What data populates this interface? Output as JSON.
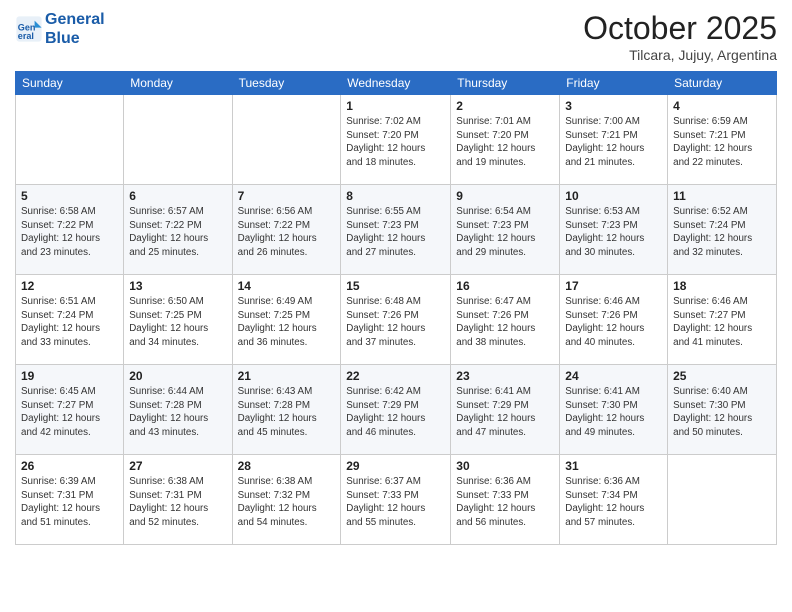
{
  "header": {
    "logo_line1": "General",
    "logo_line2": "Blue",
    "month": "October 2025",
    "location": "Tilcara, Jujuy, Argentina"
  },
  "days_of_week": [
    "Sunday",
    "Monday",
    "Tuesday",
    "Wednesday",
    "Thursday",
    "Friday",
    "Saturday"
  ],
  "weeks": [
    [
      {
        "day": "",
        "info": ""
      },
      {
        "day": "",
        "info": ""
      },
      {
        "day": "",
        "info": ""
      },
      {
        "day": "1",
        "info": "Sunrise: 7:02 AM\nSunset: 7:20 PM\nDaylight: 12 hours\nand 18 minutes."
      },
      {
        "day": "2",
        "info": "Sunrise: 7:01 AM\nSunset: 7:20 PM\nDaylight: 12 hours\nand 19 minutes."
      },
      {
        "day": "3",
        "info": "Sunrise: 7:00 AM\nSunset: 7:21 PM\nDaylight: 12 hours\nand 21 minutes."
      },
      {
        "day": "4",
        "info": "Sunrise: 6:59 AM\nSunset: 7:21 PM\nDaylight: 12 hours\nand 22 minutes."
      }
    ],
    [
      {
        "day": "5",
        "info": "Sunrise: 6:58 AM\nSunset: 7:22 PM\nDaylight: 12 hours\nand 23 minutes."
      },
      {
        "day": "6",
        "info": "Sunrise: 6:57 AM\nSunset: 7:22 PM\nDaylight: 12 hours\nand 25 minutes."
      },
      {
        "day": "7",
        "info": "Sunrise: 6:56 AM\nSunset: 7:22 PM\nDaylight: 12 hours\nand 26 minutes."
      },
      {
        "day": "8",
        "info": "Sunrise: 6:55 AM\nSunset: 7:23 PM\nDaylight: 12 hours\nand 27 minutes."
      },
      {
        "day": "9",
        "info": "Sunrise: 6:54 AM\nSunset: 7:23 PM\nDaylight: 12 hours\nand 29 minutes."
      },
      {
        "day": "10",
        "info": "Sunrise: 6:53 AM\nSunset: 7:23 PM\nDaylight: 12 hours\nand 30 minutes."
      },
      {
        "day": "11",
        "info": "Sunrise: 6:52 AM\nSunset: 7:24 PM\nDaylight: 12 hours\nand 32 minutes."
      }
    ],
    [
      {
        "day": "12",
        "info": "Sunrise: 6:51 AM\nSunset: 7:24 PM\nDaylight: 12 hours\nand 33 minutes."
      },
      {
        "day": "13",
        "info": "Sunrise: 6:50 AM\nSunset: 7:25 PM\nDaylight: 12 hours\nand 34 minutes."
      },
      {
        "day": "14",
        "info": "Sunrise: 6:49 AM\nSunset: 7:25 PM\nDaylight: 12 hours\nand 36 minutes."
      },
      {
        "day": "15",
        "info": "Sunrise: 6:48 AM\nSunset: 7:26 PM\nDaylight: 12 hours\nand 37 minutes."
      },
      {
        "day": "16",
        "info": "Sunrise: 6:47 AM\nSunset: 7:26 PM\nDaylight: 12 hours\nand 38 minutes."
      },
      {
        "day": "17",
        "info": "Sunrise: 6:46 AM\nSunset: 7:26 PM\nDaylight: 12 hours\nand 40 minutes."
      },
      {
        "day": "18",
        "info": "Sunrise: 6:46 AM\nSunset: 7:27 PM\nDaylight: 12 hours\nand 41 minutes."
      }
    ],
    [
      {
        "day": "19",
        "info": "Sunrise: 6:45 AM\nSunset: 7:27 PM\nDaylight: 12 hours\nand 42 minutes."
      },
      {
        "day": "20",
        "info": "Sunrise: 6:44 AM\nSunset: 7:28 PM\nDaylight: 12 hours\nand 43 minutes."
      },
      {
        "day": "21",
        "info": "Sunrise: 6:43 AM\nSunset: 7:28 PM\nDaylight: 12 hours\nand 45 minutes."
      },
      {
        "day": "22",
        "info": "Sunrise: 6:42 AM\nSunset: 7:29 PM\nDaylight: 12 hours\nand 46 minutes."
      },
      {
        "day": "23",
        "info": "Sunrise: 6:41 AM\nSunset: 7:29 PM\nDaylight: 12 hours\nand 47 minutes."
      },
      {
        "day": "24",
        "info": "Sunrise: 6:41 AM\nSunset: 7:30 PM\nDaylight: 12 hours\nand 49 minutes."
      },
      {
        "day": "25",
        "info": "Sunrise: 6:40 AM\nSunset: 7:30 PM\nDaylight: 12 hours\nand 50 minutes."
      }
    ],
    [
      {
        "day": "26",
        "info": "Sunrise: 6:39 AM\nSunset: 7:31 PM\nDaylight: 12 hours\nand 51 minutes."
      },
      {
        "day": "27",
        "info": "Sunrise: 6:38 AM\nSunset: 7:31 PM\nDaylight: 12 hours\nand 52 minutes."
      },
      {
        "day": "28",
        "info": "Sunrise: 6:38 AM\nSunset: 7:32 PM\nDaylight: 12 hours\nand 54 minutes."
      },
      {
        "day": "29",
        "info": "Sunrise: 6:37 AM\nSunset: 7:33 PM\nDaylight: 12 hours\nand 55 minutes."
      },
      {
        "day": "30",
        "info": "Sunrise: 6:36 AM\nSunset: 7:33 PM\nDaylight: 12 hours\nand 56 minutes."
      },
      {
        "day": "31",
        "info": "Sunrise: 6:36 AM\nSunset: 7:34 PM\nDaylight: 12 hours\nand 57 minutes."
      },
      {
        "day": "",
        "info": ""
      }
    ]
  ]
}
